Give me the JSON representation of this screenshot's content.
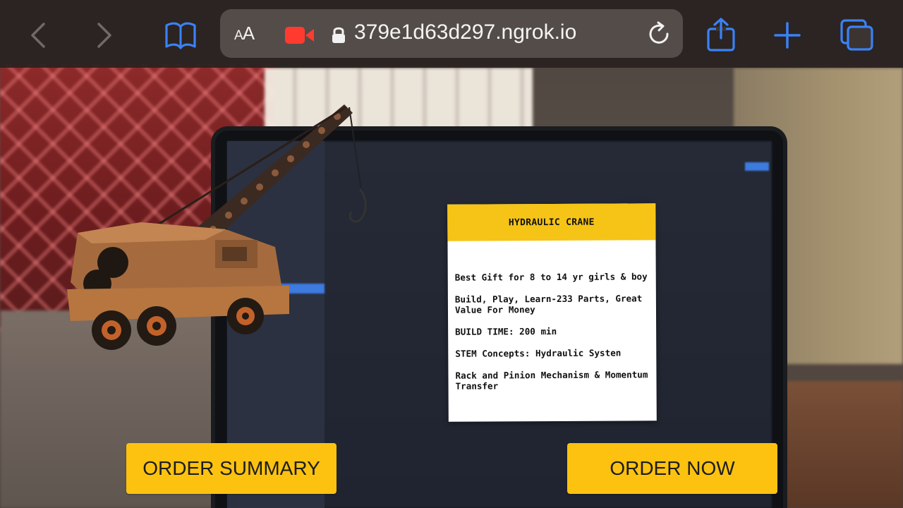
{
  "browser": {
    "text_size_label_small": "A",
    "text_size_label_large": "A",
    "url": "379e1d63d297.ngrok.io",
    "icons": {
      "back": "chevron-left-icon",
      "forward": "chevron-right-icon",
      "bookmarks": "book-icon",
      "camera": "video-camera-icon",
      "lock": "lock-icon",
      "reload": "reload-icon",
      "share": "share-icon",
      "new_tab": "plus-icon",
      "tabs": "tabs-icon"
    },
    "accent_color": "#3a82f7",
    "camera_color": "#ff3b30"
  },
  "product_card": {
    "title": "HYDRAULIC CRANE",
    "lines": [
      "Best Gift for 8 to 14 yr girls & boy",
      "Build, Play, Learn-233 Parts, Great Value For Money",
      "BUILD TIME: 200 min",
      "STEM Concepts: Hydraulic Systen",
      "Rack and Pinion Mechanism & Momentum Transfer"
    ],
    "header_color": "#f6c417"
  },
  "actions": {
    "order_summary_label": "ORDER SUMMARY",
    "order_now_label": "ORDER NOW",
    "button_color": "#fdc210"
  }
}
